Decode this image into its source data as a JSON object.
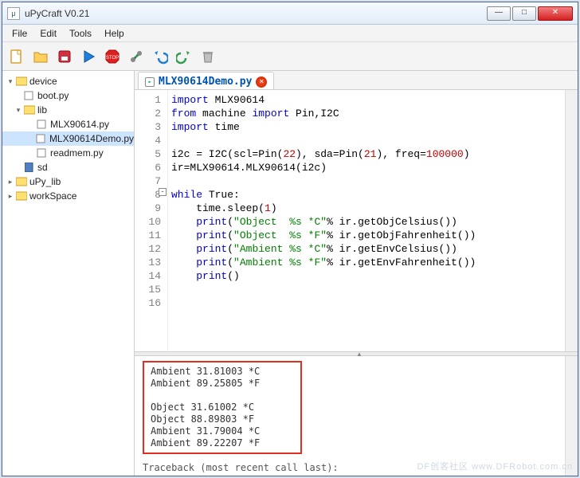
{
  "window": {
    "title": "uPyCraft V0.21"
  },
  "menu": [
    "File",
    "Edit",
    "Tools",
    "Help"
  ],
  "toolbar_icons": [
    "new-file",
    "open-file",
    "save-file",
    "run",
    "stop",
    "connect",
    "undo",
    "redo",
    "delete"
  ],
  "tree": {
    "root": "device",
    "items": [
      {
        "label": "boot.py",
        "depth": 1,
        "icon": "py"
      },
      {
        "label": "lib",
        "depth": 1,
        "icon": "folder",
        "arrow": "▾"
      },
      {
        "label": "MLX90614.py",
        "depth": 2,
        "icon": "py"
      },
      {
        "label": "MLX90614Demo.py",
        "depth": 2,
        "icon": "py",
        "selected": true
      },
      {
        "label": "readmem.py",
        "depth": 2,
        "icon": "py"
      },
      {
        "label": "sd",
        "depth": 1,
        "icon": "sd"
      },
      {
        "label": "uPy_lib",
        "depth": 0,
        "icon": "folder",
        "arrow": "▸",
        "top": true
      },
      {
        "label": "workSpace",
        "depth": 0,
        "icon": "folder",
        "arrow": "▸",
        "top": true
      }
    ]
  },
  "tab": {
    "label": "MLX90614Demo.py"
  },
  "code": {
    "lines": [
      [
        {
          "c": "k-blue",
          "t": "import"
        },
        {
          "t": " MLX90614"
        }
      ],
      [
        {
          "c": "k-blue",
          "t": "from"
        },
        {
          "t": " machine "
        },
        {
          "c": "k-blue",
          "t": "import"
        },
        {
          "t": " Pin,I2C"
        }
      ],
      [
        {
          "c": "k-blue",
          "t": "import"
        },
        {
          "t": " time"
        }
      ],
      [],
      [
        {
          "t": "i2c = I2C(scl=Pin("
        },
        {
          "c": "k-red",
          "t": "22"
        },
        {
          "t": "), sda=Pin("
        },
        {
          "c": "k-red",
          "t": "21"
        },
        {
          "t": "), freq="
        },
        {
          "c": "k-red",
          "t": "100000"
        },
        {
          "t": ")"
        }
      ],
      [
        {
          "t": "ir=MLX90614.MLX90614(i2c)"
        }
      ],
      [],
      [
        {
          "c": "k-blue",
          "t": "while"
        },
        {
          "t": " True:"
        }
      ],
      [
        {
          "t": "    time.sleep("
        },
        {
          "c": "k-red",
          "t": "1"
        },
        {
          "t": ")"
        }
      ],
      [
        {
          "t": "    "
        },
        {
          "c": "k-blue",
          "t": "print"
        },
        {
          "t": "("
        },
        {
          "c": "k-green",
          "t": "\"Object  %s *C\""
        },
        {
          "t": "% ir.getObjCelsius())"
        }
      ],
      [
        {
          "t": "    "
        },
        {
          "c": "k-blue",
          "t": "print"
        },
        {
          "t": "("
        },
        {
          "c": "k-green",
          "t": "\"Object  %s *F\""
        },
        {
          "t": "% ir.getObjFahrenheit())"
        }
      ],
      [
        {
          "t": "    "
        },
        {
          "c": "k-blue",
          "t": "print"
        },
        {
          "t": "("
        },
        {
          "c": "k-green",
          "t": "\"Ambient %s *C\""
        },
        {
          "t": "% ir.getEnvCelsius())"
        }
      ],
      [
        {
          "t": "    "
        },
        {
          "c": "k-blue",
          "t": "print"
        },
        {
          "t": "("
        },
        {
          "c": "k-green",
          "t": "\"Ambient %s *F\""
        },
        {
          "t": "% ir.getEnvFahrenheit())"
        }
      ],
      [
        {
          "t": "    "
        },
        {
          "c": "k-blue",
          "t": "print"
        },
        {
          "t": "()"
        }
      ],
      [],
      []
    ]
  },
  "console": {
    "lines": [
      "Ambient 31.81003 *C",
      "Ambient 89.25805 *F",
      "",
      "Object  31.61002 *C",
      "Object  88.89803 *F",
      "Ambient 31.79004 *C",
      "Ambient 89.22207 *F"
    ],
    "trace": "Traceback (most recent call last):"
  },
  "watermark": "DF创客社区\nwww.DFRobot.com.cn"
}
